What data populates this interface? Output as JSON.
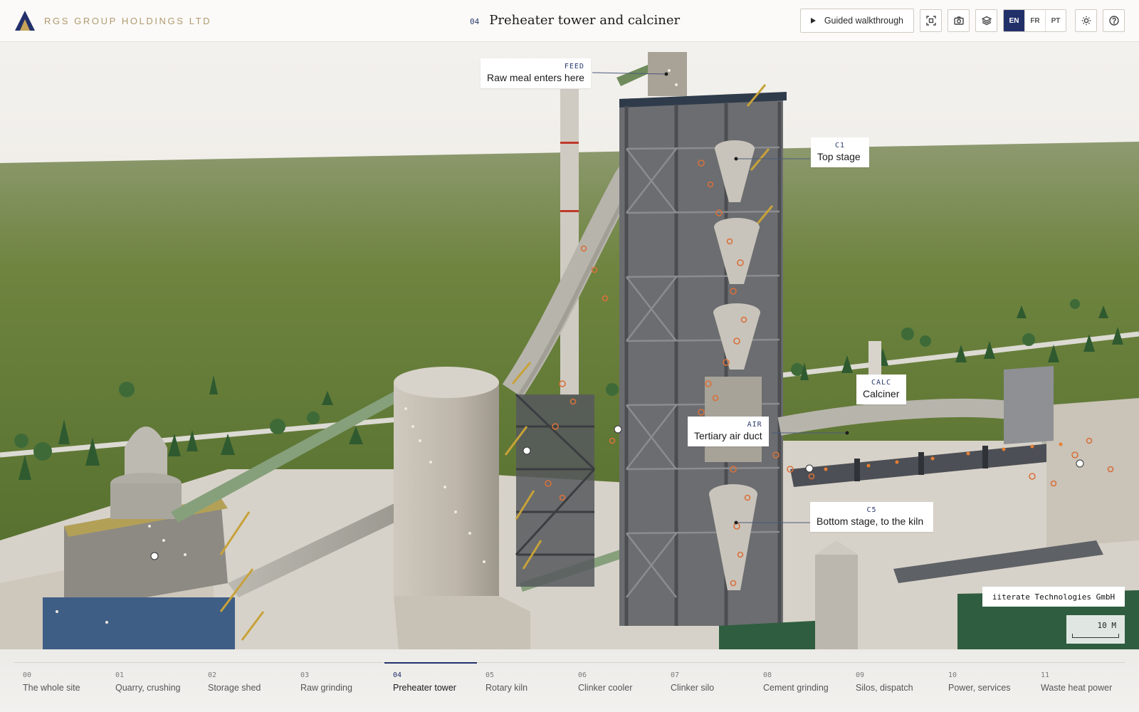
{
  "header": {
    "company": "RGS GROUP HOLDINGS LTD",
    "step_number": "04",
    "title": "Preheater tower and calciner",
    "walkthrough_label": "Guided walkthrough",
    "icons": [
      "fit-view-icon",
      "camera-icon",
      "layers-icon"
    ],
    "languages": [
      {
        "code": "EN",
        "active": true
      },
      {
        "code": "FR",
        "active": false
      },
      {
        "code": "PT",
        "active": false
      }
    ],
    "theme_icon": "sun-icon",
    "help_icon": "help-icon"
  },
  "callouts": {
    "feed": {
      "code": "FEED",
      "label": "Raw meal enters here"
    },
    "c1": {
      "code": "C1",
      "label": "Top stage"
    },
    "calc": {
      "code": "CALC",
      "label": "Calciner"
    },
    "air": {
      "code": "AIR",
      "label": "Tertiary air duct"
    },
    "c5": {
      "code": "C5",
      "label": "Bottom stage, to the kiln"
    }
  },
  "credit": "iiterate Technologies GmbH",
  "scale_label": "10 M",
  "colors": {
    "accent": "#22306a",
    "brand": "#b09a6e",
    "particles": "#d9703a"
  },
  "nav": [
    {
      "num": "00",
      "label": "The whole site"
    },
    {
      "num": "01",
      "label": "Quarry, crushing"
    },
    {
      "num": "02",
      "label": "Storage shed"
    },
    {
      "num": "03",
      "label": "Raw grinding"
    },
    {
      "num": "04",
      "label": "Preheater tower"
    },
    {
      "num": "05",
      "label": "Rotary kiln"
    },
    {
      "num": "06",
      "label": "Clinker cooler"
    },
    {
      "num": "07",
      "label": "Clinker silo"
    },
    {
      "num": "08",
      "label": "Cement grinding"
    },
    {
      "num": "09",
      "label": "Silos, dispatch"
    },
    {
      "num": "10",
      "label": "Power, services"
    },
    {
      "num": "11",
      "label": "Waste heat power"
    }
  ],
  "active_nav": "04"
}
